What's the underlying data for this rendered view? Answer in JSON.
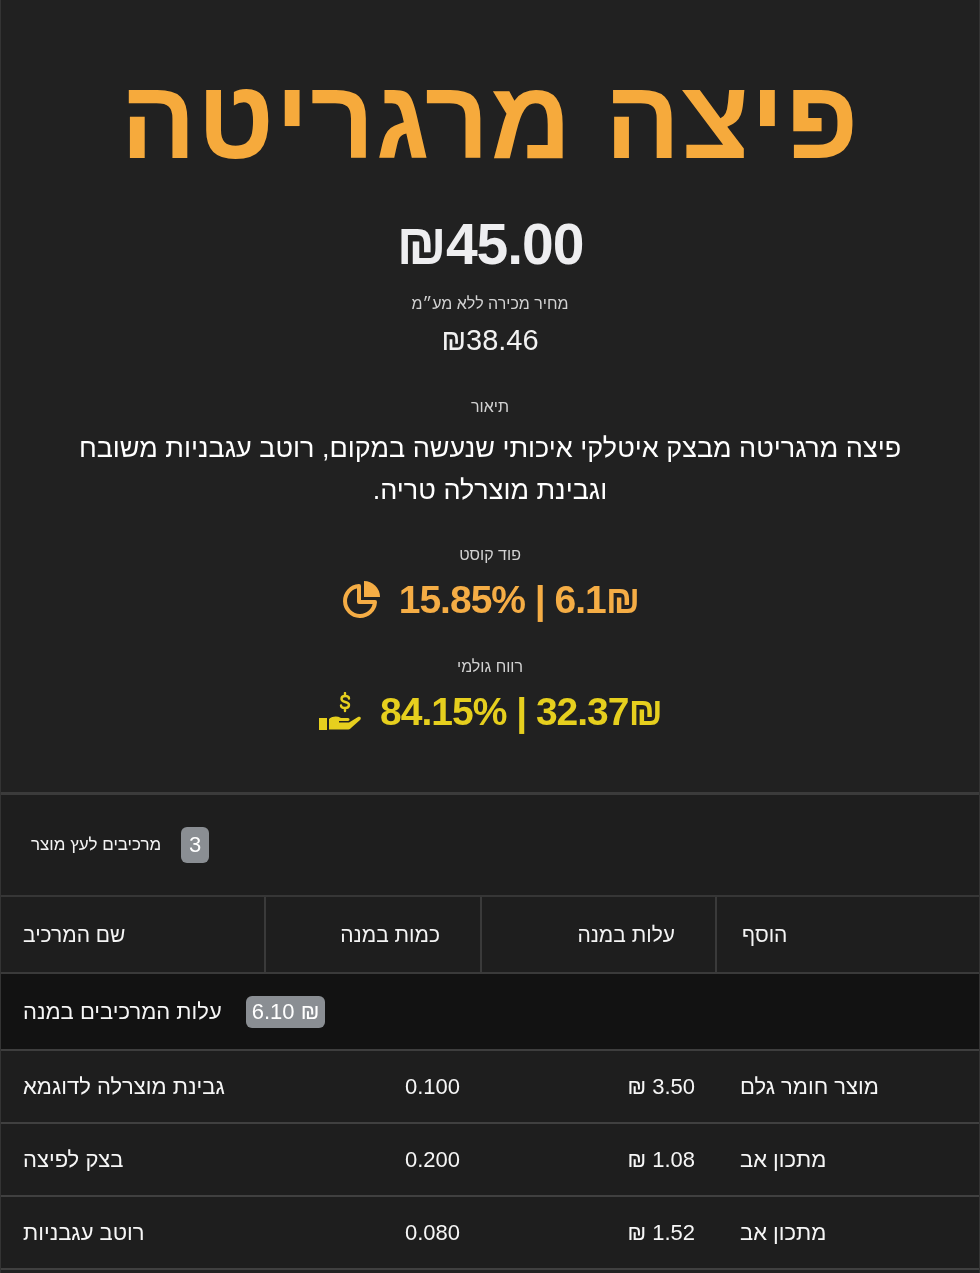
{
  "product": {
    "title": "פיצה מרגריטה",
    "price": "₪45.00",
    "net_price_label": "מחיר מכירה ללא מע״מ",
    "net_price": "₪38.46",
    "description_label": "תיאור",
    "description": "פיצה מרגריטה מבצק איטלקי איכותי שנעשה במקום, רוטב עגבניות משובח וגבינת מוצרלה טריה."
  },
  "metrics": [
    {
      "kind": "food_cost",
      "label": "פוד קוסט",
      "value": "15.85% | 6.1₪",
      "color": "#f5ad45"
    },
    {
      "kind": "gross_profit",
      "label": "רווח גולמי",
      "value": "84.15% | 32.37₪",
      "color": "#e6cf1e"
    }
  ],
  "ingredients": {
    "title": "מרכיבים לעץ מוצר",
    "count": "3",
    "columns": [
      "הוסף",
      "עלות במנה",
      "כמות במנה",
      "שם המרכיב"
    ],
    "summary": {
      "label": "עלות המרכיבים במנה",
      "value": "6.10 ₪"
    },
    "rows": [
      {
        "type": "מוצר חומר גלם",
        "cost": "3.50 ₪",
        "quantity": "0.100",
        "name": "גבינת מוצרלה לדוגמא"
      },
      {
        "type": "מתכון אב",
        "cost": "1.08 ₪",
        "quantity": "0.200",
        "name": "בצק לפיצה"
      },
      {
        "type": "מתכון אב",
        "cost": "1.52 ₪",
        "quantity": "0.080",
        "name": "רוטב עגבניות"
      }
    ]
  }
}
